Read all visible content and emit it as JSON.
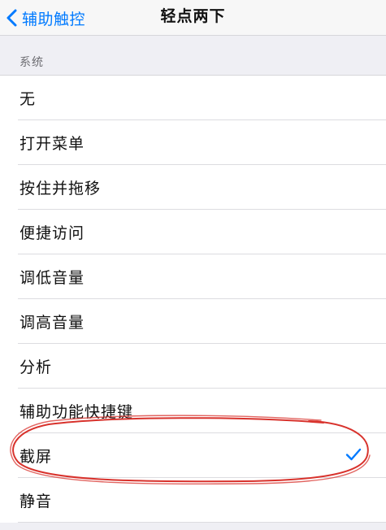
{
  "nav": {
    "back_label": "辅助触控",
    "title": "轻点两下"
  },
  "section": {
    "header": "系统"
  },
  "items": [
    {
      "label": "无"
    },
    {
      "label": "打开菜单"
    },
    {
      "label": "按住并拖移"
    },
    {
      "label": "便捷访问"
    },
    {
      "label": "调低音量"
    },
    {
      "label": "调高音量"
    },
    {
      "label": "分析"
    },
    {
      "label": "辅助功能快捷键"
    },
    {
      "label": "截屏",
      "selected": true
    },
    {
      "label": "静音"
    }
  ],
  "colors": {
    "accent": "#007aff",
    "annotation": "#d8322c"
  }
}
